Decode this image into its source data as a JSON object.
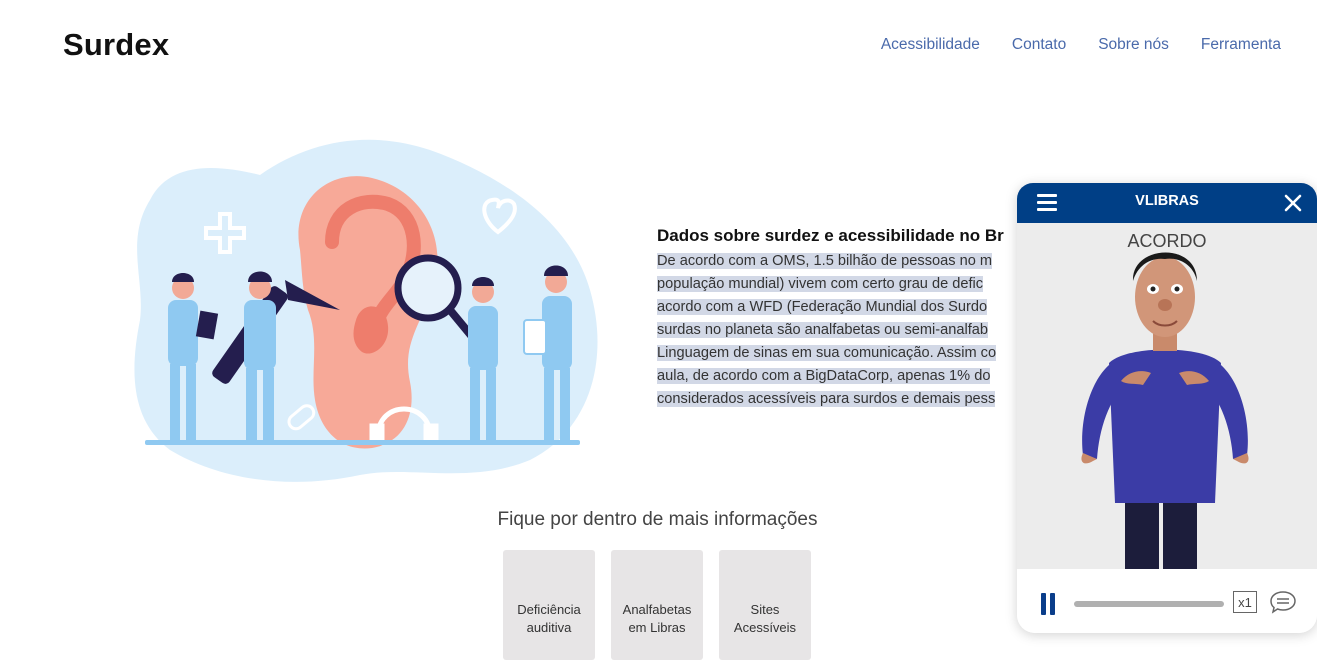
{
  "header": {
    "logo": "Surdex",
    "nav": [
      "Acessibilidade",
      "Contato",
      "Sobre nós",
      "Ferramenta"
    ]
  },
  "info": {
    "title": "Dados sobre surdez e acessibilidade no Br",
    "lines": [
      "De acordo com a OMS, 1.5 bilhão de pessoas no m",
      "população mundial) vivem com certo grau de defic",
      "acordo com a WFD (Federação Mundial dos Surdo",
      "surdas no planeta são analfabetas ou semi-analfab",
      "Linguagem de sinas em sua comunicação. Assim co",
      "aula, de acordo com a BigDataCorp, apenas 1% do",
      "considerados acessíveis para surdos e demais pess"
    ]
  },
  "more": {
    "title": "Fique por dentro de mais informações",
    "cards": [
      {
        "line1": "Deficiência",
        "line2": "auditiva"
      },
      {
        "line1": "Analfabetas",
        "line2": "em Libras"
      },
      {
        "line1": "Sites",
        "line2": "Acessíveis"
      }
    ]
  },
  "vlibras": {
    "title": "VLIBRAS",
    "word": "ACORDO",
    "speed": "x1",
    "progress": 0.0,
    "colors": {
      "header": "#003f86",
      "accent": "#0a3d8a"
    },
    "icons": {
      "menu": "hamburger-icon",
      "close": "close-icon",
      "pause": "pause-icon",
      "subtitles": "speech-bubble-icon"
    }
  },
  "illustration": {
    "icons": [
      "ear",
      "otoscope",
      "magnifying-glass",
      "doctors",
      "heart",
      "plus",
      "pill",
      "headphones"
    ]
  }
}
